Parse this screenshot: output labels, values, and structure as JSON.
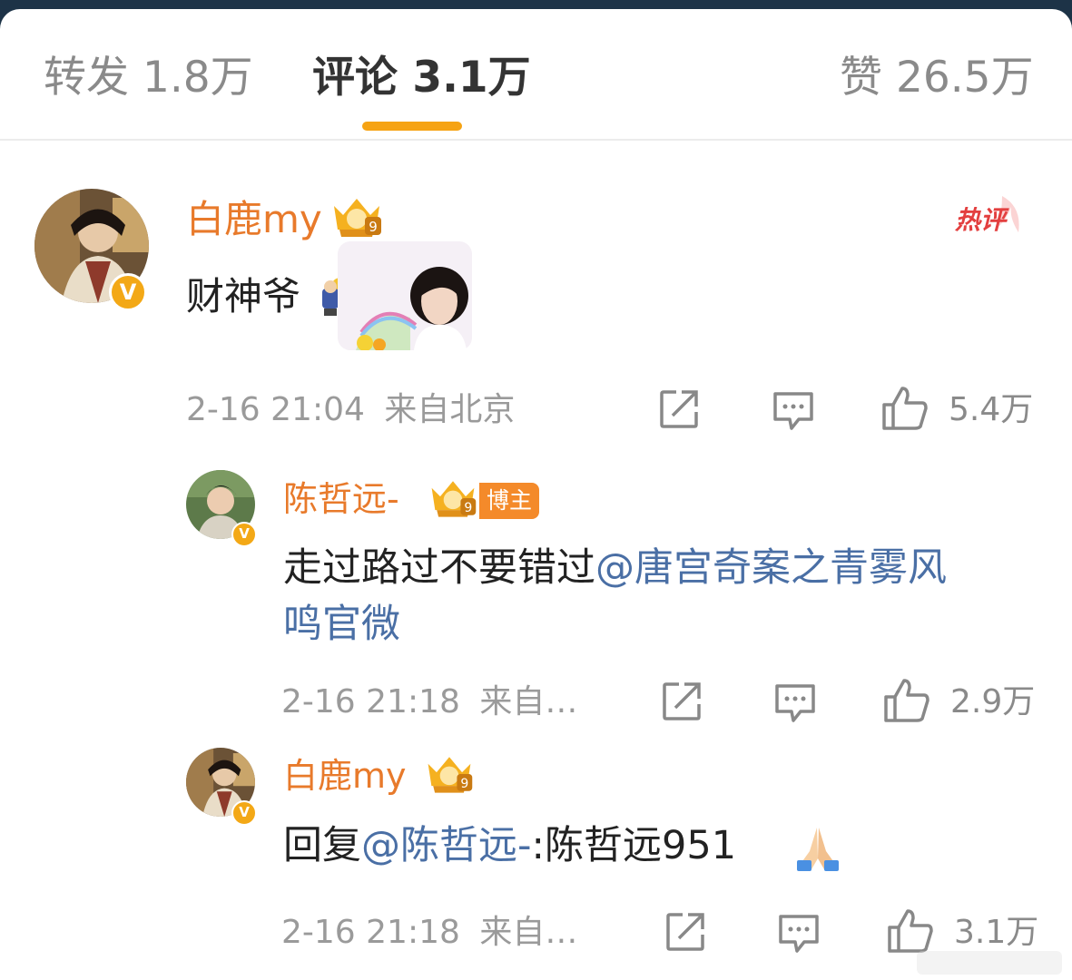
{
  "tabs": [
    {
      "label": "转发 1.8万"
    },
    {
      "label": "评论 3.1万"
    },
    {
      "label": "赞 26.5万"
    }
  ],
  "colors": {
    "accent": "#f6a313",
    "username": "#e87a2b",
    "mention": "#4a6fa5",
    "hot": "#e33f3f"
  },
  "comments": [
    {
      "username": "白鹿my",
      "level": "9",
      "hot_label": "热评",
      "text": "财神爷",
      "time": "2-16 21:04",
      "location": "来自北京",
      "likes": "5.4万"
    },
    {
      "username": "陈哲远-",
      "level": "9",
      "role": "博主",
      "text_plain": "走过路过不要错过",
      "mention_line1": "@唐宫奇案之青雾风",
      "mention_line2": "鸣官微",
      "time": "2-16 21:18",
      "location": "来自…",
      "likes": "2.9万"
    },
    {
      "username": "白鹿my",
      "level": "9",
      "reply_prefix": "回复",
      "mention": "@陈哲远-",
      "text": ":陈哲远951",
      "time": "2-16 21:18",
      "location": "来自…",
      "likes": "3.1万"
    }
  ],
  "icons": [
    "share-icon",
    "comment-icon",
    "like-icon",
    "crown-badge-icon",
    "verified-icon",
    "prayer-emoji-icon",
    "god-of-wealth-emoji-icon"
  ]
}
